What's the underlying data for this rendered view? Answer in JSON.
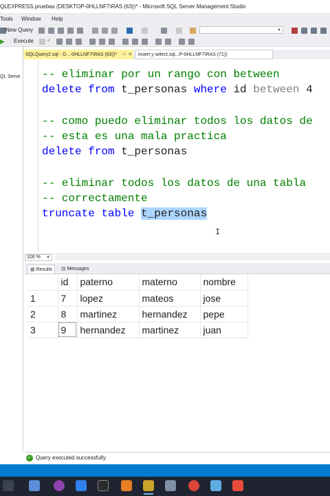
{
  "window": {
    "title": "QLEXPRESS.pruebas (DESKTOP-0HLLNF7\\RAS (63))* - Microsoft SQL Server Management Studio"
  },
  "menu": {
    "items": [
      "Tools",
      "Window",
      "Help"
    ]
  },
  "toolbar": {
    "new_query_label": "New Query",
    "execute_label": "Execute"
  },
  "object_explorer": {
    "partial_label": "QL Serve"
  },
  "tabs": [
    {
      "label": "SQLQuery2.sql - D...-0HLLNF7\\RAS (63))*",
      "active": true
    },
    {
      "label": "insert y select.sql...P-0HLLNF7\\RAS (71))",
      "active": false
    }
  ],
  "editor": {
    "lines": [
      {
        "segments": [
          {
            "cls": "cmt",
            "text": "-- eliminar por un rango con between"
          }
        ]
      },
      {
        "segments": [
          {
            "cls": "kw",
            "text": "delete from "
          },
          {
            "cls": "ident",
            "text": "t_personas "
          },
          {
            "cls": "kw",
            "text": "where "
          },
          {
            "cls": "ident",
            "text": "id "
          },
          {
            "cls": "gray",
            "text": "between "
          },
          {
            "cls": "ident",
            "text": "4"
          }
        ]
      },
      {
        "segments": []
      },
      {
        "segments": [
          {
            "cls": "cmt",
            "text": "-- como puedo eliminar todos los datos de"
          }
        ]
      },
      {
        "segments": [
          {
            "cls": "cmt",
            "text": "-- esta es una mala practica"
          }
        ]
      },
      {
        "segments": [
          {
            "cls": "kw",
            "text": "delete from "
          },
          {
            "cls": "ident",
            "text": "t_personas"
          }
        ]
      },
      {
        "segments": []
      },
      {
        "segments": [
          {
            "cls": "cmt",
            "text": "-- eliminar todos los datos de una tabla"
          }
        ]
      },
      {
        "segments": [
          {
            "cls": "cmt",
            "text": "-- correctamente"
          }
        ]
      },
      {
        "segments": [
          {
            "cls": "kw",
            "text": "truncate table "
          },
          {
            "cls": "ident sel",
            "text": "t_personas"
          }
        ]
      }
    ]
  },
  "zoom": {
    "value": "100 %"
  },
  "results": {
    "tabs": [
      "Results",
      "Messages"
    ],
    "columns": [
      "id",
      "paterno",
      "materno",
      "nombre"
    ],
    "rows": [
      {
        "num": "1",
        "cells": [
          "7",
          "lopez",
          "mateos",
          "jose"
        ]
      },
      {
        "num": "2",
        "cells": [
          "8",
          "martinez",
          "hernandez",
          "pepe"
        ]
      },
      {
        "num": "3",
        "cells": [
          "9",
          "hernandez",
          "martinez",
          "juan"
        ]
      }
    ]
  },
  "status": {
    "message": "Query executed successfully."
  },
  "colors": {
    "accent": "#007acc",
    "tab_active": "#fff29d",
    "comment": "#008000",
    "keyword": "#0000ff",
    "success": "#3a9d23"
  },
  "taskbar": {
    "icons": [
      "search-taskbar-icon",
      "files-taskbar-icon",
      "github-desktop-icon",
      "vscode-icon",
      "terminal-icon",
      "xampp-icon",
      "ssms-icon",
      "paint-icon",
      "chrome-icon",
      "azure-data-studio-icon",
      "app-red-icon"
    ]
  }
}
